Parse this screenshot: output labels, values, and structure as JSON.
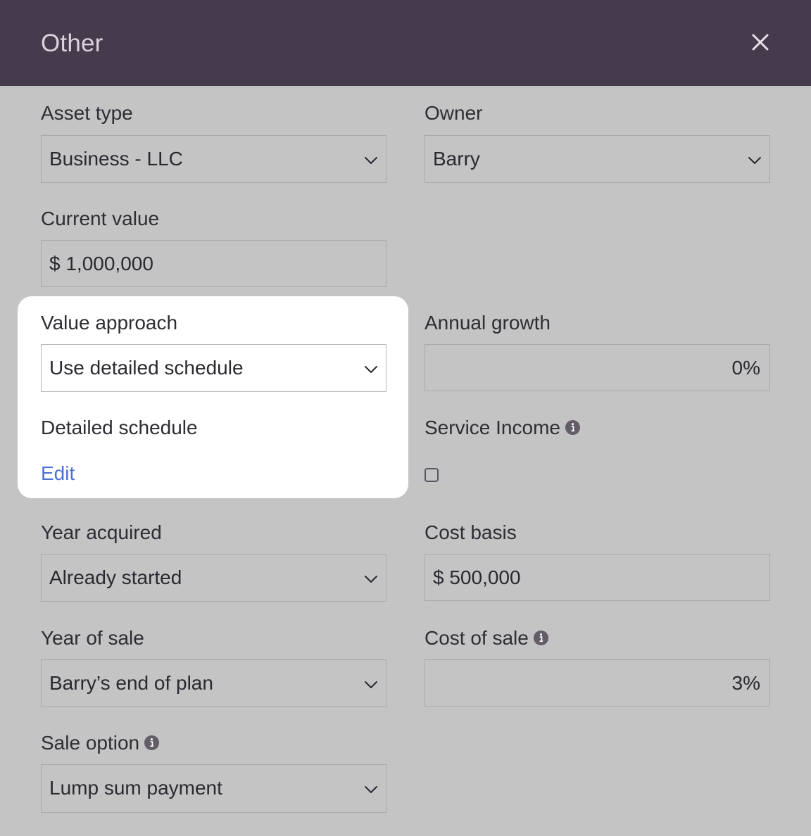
{
  "dialog": {
    "title": "Other",
    "close_icon": "close-icon"
  },
  "fields": {
    "asset_type": {
      "label": "Asset type",
      "value": "Business - LLC"
    },
    "owner": {
      "label": "Owner",
      "value": "Barry"
    },
    "current_value": {
      "label": "Current value",
      "value": "$ 1,000,000"
    },
    "value_approach": {
      "label": "Value approach",
      "value": "Use detailed schedule"
    },
    "annual_growth": {
      "label": "Annual growth",
      "value": "0%"
    },
    "detailed_schedule": {
      "label": "Detailed schedule",
      "link": "Edit"
    },
    "service_income": {
      "label": "Service Income",
      "checked": false
    },
    "year_acquired": {
      "label": "Year acquired",
      "value": "Already started"
    },
    "cost_basis": {
      "label": "Cost basis",
      "value": "$ 500,000"
    },
    "year_of_sale": {
      "label": "Year of sale",
      "value": "Barry’s end of plan"
    },
    "cost_of_sale": {
      "label": "Cost of sale",
      "value": "3%"
    },
    "sale_option": {
      "label": "Sale option",
      "value": "Lump sum payment"
    }
  },
  "colors": {
    "header_bg": "#463a4d",
    "overlay_bg": "#c4c4c4",
    "highlight_bg": "#ffffff",
    "link": "#4f6fd8"
  }
}
